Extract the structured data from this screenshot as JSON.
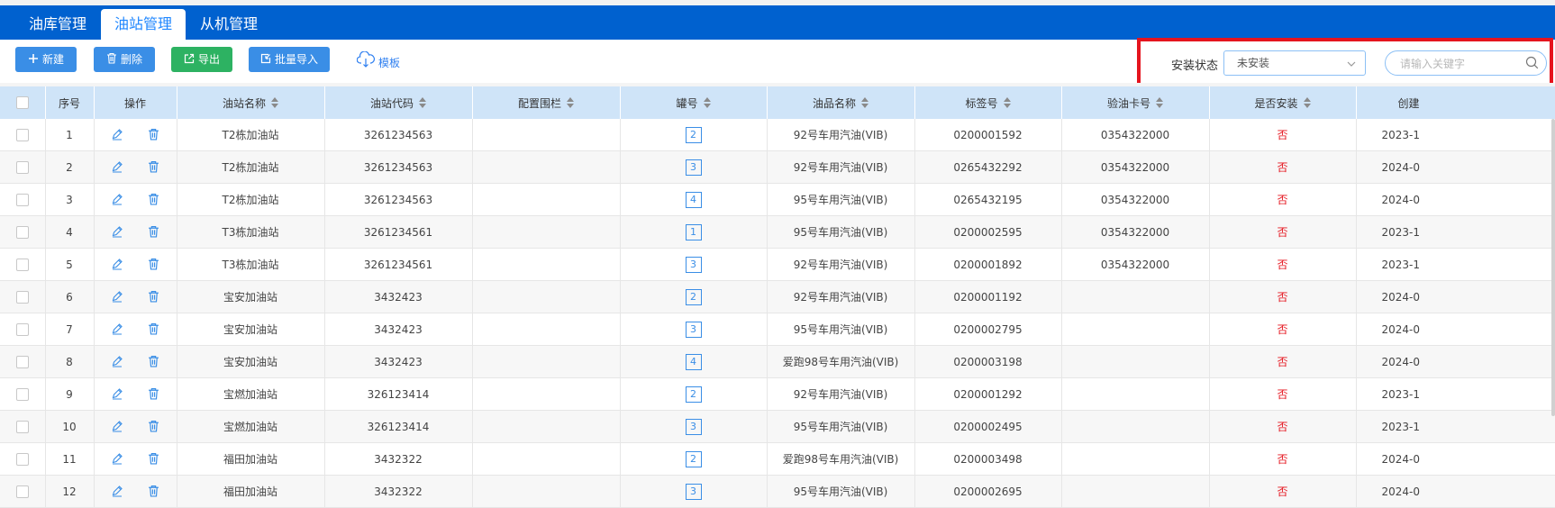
{
  "tabs": [
    "油库管理",
    "油站管理",
    "从机管理"
  ],
  "toolbar": {
    "new_label": "新建",
    "delete_label": "删除",
    "export_label": "导出",
    "batch_import_label": "批量导入",
    "template_label": "模板"
  },
  "filter": {
    "label": "安装状态",
    "status_value": "未安装",
    "search_placeholder": "请输入关键字"
  },
  "table": {
    "columns": [
      "序号",
      "操作",
      "油站名称",
      "油站代码",
      "配置围栏",
      "罐号",
      "油品名称",
      "标签号",
      "验油卡号",
      "是否安装",
      "创建"
    ],
    "rows": [
      {
        "no": "1",
        "station": "T2栋加油站",
        "code": "3261234563",
        "fence": "",
        "tank": "2",
        "oil": "92号车用汽油(VIB)",
        "tag": "0200001592",
        "card": "0354322000",
        "installed": "否",
        "created": "2023-1"
      },
      {
        "no": "2",
        "station": "T2栋加油站",
        "code": "3261234563",
        "fence": "",
        "tank": "3",
        "oil": "92号车用汽油(VIB)",
        "tag": "0265432292",
        "card": "0354322000",
        "installed": "否",
        "created": "2024-0"
      },
      {
        "no": "3",
        "station": "T2栋加油站",
        "code": "3261234563",
        "fence": "",
        "tank": "4",
        "oil": "95号车用汽油(VIB)",
        "tag": "0265432195",
        "card": "0354322000",
        "installed": "否",
        "created": "2024-0"
      },
      {
        "no": "4",
        "station": "T3栋加油站",
        "code": "3261234561",
        "fence": "",
        "tank": "1",
        "oil": "95号车用汽油(VIB)",
        "tag": "0200002595",
        "card": "0354322000",
        "installed": "否",
        "created": "2023-1"
      },
      {
        "no": "5",
        "station": "T3栋加油站",
        "code": "3261234561",
        "fence": "",
        "tank": "3",
        "oil": "92号车用汽油(VIB)",
        "tag": "0200001892",
        "card": "0354322000",
        "installed": "否",
        "created": "2023-1"
      },
      {
        "no": "6",
        "station": "宝安加油站",
        "code": "3432423",
        "fence": "",
        "tank": "2",
        "oil": "92号车用汽油(VIB)",
        "tag": "0200001192",
        "card": "",
        "installed": "否",
        "created": "2024-0"
      },
      {
        "no": "7",
        "station": "宝安加油站",
        "code": "3432423",
        "fence": "",
        "tank": "3",
        "oil": "95号车用汽油(VIB)",
        "tag": "0200002795",
        "card": "",
        "installed": "否",
        "created": "2024-0"
      },
      {
        "no": "8",
        "station": "宝安加油站",
        "code": "3432423",
        "fence": "",
        "tank": "4",
        "oil": "爱跑98号车用汽油(VIB)",
        "tag": "0200003198",
        "card": "",
        "installed": "否",
        "created": "2024-0"
      },
      {
        "no": "9",
        "station": "宝燃加油站",
        "code": "326123414",
        "fence": "",
        "tank": "2",
        "oil": "92号车用汽油(VIB)",
        "tag": "0200001292",
        "card": "",
        "installed": "否",
        "created": "2023-1"
      },
      {
        "no": "10",
        "station": "宝燃加油站",
        "code": "326123414",
        "fence": "",
        "tank": "3",
        "oil": "95号车用汽油(VIB)",
        "tag": "0200002495",
        "card": "",
        "installed": "否",
        "created": "2023-1"
      },
      {
        "no": "11",
        "station": "福田加油站",
        "code": "3432322",
        "fence": "",
        "tank": "2",
        "oil": "爱跑98号车用汽油(VIB)",
        "tag": "0200003498",
        "card": "",
        "installed": "否",
        "created": "2024-0"
      },
      {
        "no": "12",
        "station": "福田加油站",
        "code": "3432322",
        "fence": "",
        "tank": "3",
        "oil": "95号车用汽油(VIB)",
        "tag": "0200002695",
        "card": "",
        "installed": "否",
        "created": "2024-0"
      }
    ]
  },
  "colors": {
    "brand_blue": "#0061cf",
    "accent_blue": "#3a8ee6",
    "export_green": "#2db262",
    "highlight_red": "#e5141e",
    "header_blue": "#cfe4f8"
  }
}
